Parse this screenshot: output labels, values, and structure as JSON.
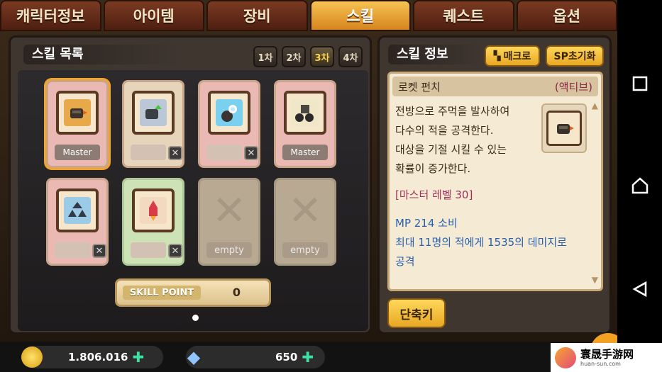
{
  "tabs": [
    {
      "label": "캐릭터정보",
      "active": false
    },
    {
      "label": "아이템",
      "active": false
    },
    {
      "label": "장비",
      "active": false
    },
    {
      "label": "스킬",
      "active": true
    },
    {
      "label": "퀘스트",
      "active": false
    },
    {
      "label": "옵션",
      "active": false
    }
  ],
  "skill_list": {
    "title": "스킬 목록",
    "job_tabs": [
      {
        "label": "1차",
        "active": false
      },
      {
        "label": "2차",
        "active": false
      },
      {
        "label": "3차",
        "active": true
      },
      {
        "label": "4차",
        "active": false
      }
    ],
    "cards": [
      {
        "status": "Master",
        "icon": "rocket-punch-icon",
        "style": "pink",
        "selected": true
      },
      {
        "status": "",
        "icon": "gear-upgrade-icon",
        "style": "beige",
        "selected": false
      },
      {
        "status": "",
        "icon": "energy-blast-icon",
        "style": "pink",
        "selected": false
      },
      {
        "status": "Master",
        "icon": "robot-summon-icon",
        "style": "pink",
        "selected": false
      },
      {
        "status": "",
        "icon": "triple-bomb-icon",
        "style": "pink",
        "selected": false
      },
      {
        "status": "",
        "icon": "rocket-booster-icon",
        "style": "green",
        "selected": false
      },
      {
        "status": "empty",
        "icon": "empty-slot-icon",
        "style": "empty",
        "selected": false
      },
      {
        "status": "empty",
        "icon": "empty-slot-icon",
        "style": "empty",
        "selected": false
      }
    ],
    "skill_point_label": "SKILL POINT",
    "skill_point_value": "0"
  },
  "skill_info": {
    "title": "스킬 정보",
    "macro_label": "매크로",
    "sp_reset_label": "SP초기화",
    "skill_name": "로켓 펀치",
    "skill_type": "(액티브)",
    "description_lines": [
      "전방으로 주먹을 발사하여",
      "다수의 적을 공격한다.",
      "대상을 기절 시킬 수 있는",
      "확률이 증가한다."
    ],
    "master_level": "[마스터 레벨 30]",
    "effect_lines": [
      "MP 214 소비",
      "최대 11명의 적에게 1535의 데미지로",
      "공격"
    ],
    "shortcut_label": "단축키"
  },
  "currency": {
    "meso": "1.806.016",
    "gems": "650"
  },
  "watermark": {
    "title": "寰晟手游网",
    "subtitle": "huan-sun.com"
  },
  "colors": {
    "active_tab": "#f6c251",
    "panel": "#3f3630",
    "accent_button": "#ffd75a",
    "master_level_text": "#a0305a",
    "effect_text": "#2860b0"
  }
}
